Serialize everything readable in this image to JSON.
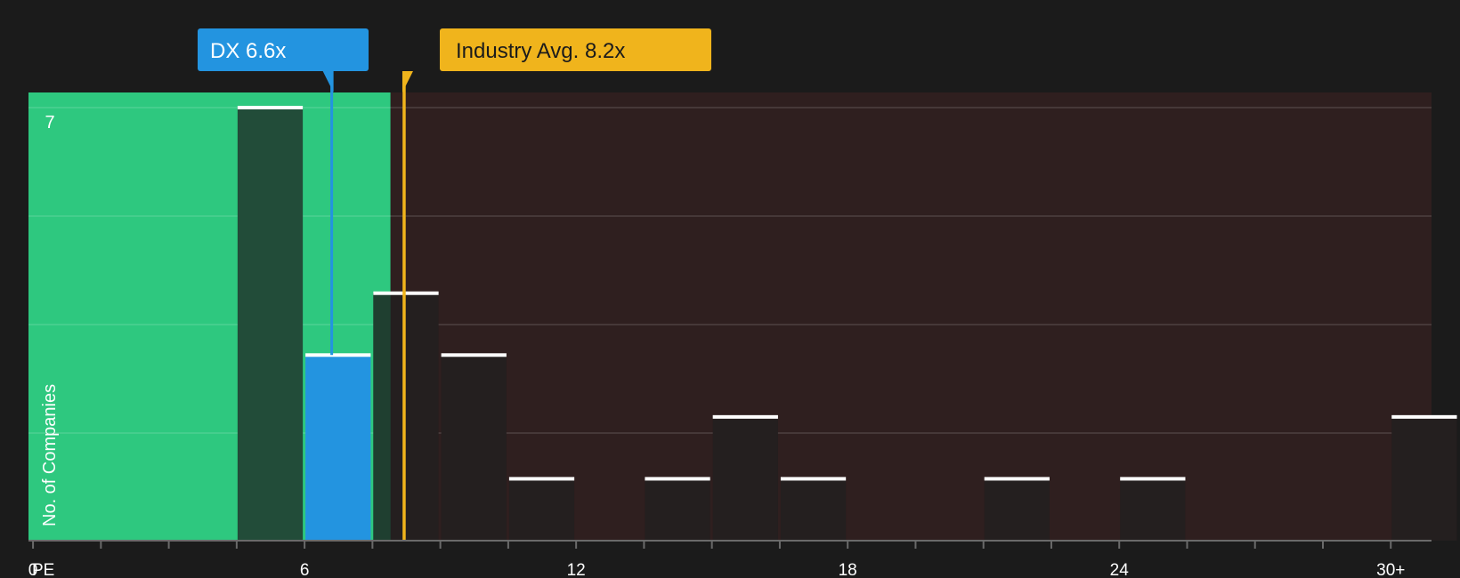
{
  "chart_data": {
    "type": "bar",
    "x_axis_prefix": "PE",
    "ylabel": "No. of Companies",
    "ylim": [
      0,
      7
    ],
    "y_top_label": "7",
    "xlim": [
      -0.1,
      30.9
    ],
    "x_ticks": [
      {
        "value": 0,
        "label": "0"
      },
      {
        "value": 6,
        "label": "6"
      },
      {
        "value": 12,
        "label": "12"
      },
      {
        "value": 18,
        "label": "18"
      },
      {
        "value": 24,
        "label": "24"
      },
      {
        "value": 30,
        "label": "30+"
      }
    ],
    "bins": [
      {
        "start": 4.5,
        "end": 6.0,
        "count": 7,
        "segment": "below"
      },
      {
        "start": 6.0,
        "end": 7.5,
        "count": 3,
        "segment": "company"
      },
      {
        "start": 7.5,
        "end": 9.0,
        "count": 4,
        "segment": "above"
      },
      {
        "start": 9.0,
        "end": 10.5,
        "count": 3,
        "segment": "above"
      },
      {
        "start": 10.5,
        "end": 12.0,
        "count": 1,
        "segment": "above"
      },
      {
        "start": 13.5,
        "end": 15.0,
        "count": 1,
        "segment": "above"
      },
      {
        "start": 15.0,
        "end": 16.5,
        "count": 2,
        "segment": "above"
      },
      {
        "start": 16.5,
        "end": 18.0,
        "count": 1,
        "segment": "above"
      },
      {
        "start": 21.0,
        "end": 22.5,
        "count": 1,
        "segment": "above"
      },
      {
        "start": 24.0,
        "end": 25.5,
        "count": 1,
        "segment": "above"
      },
      {
        "start": 30.0,
        "end": 31.5,
        "count": 2,
        "segment": "above"
      }
    ],
    "fair_region_end": 7.9,
    "company": {
      "label": "DX 6.6x",
      "value": 6.6,
      "color": "#2394e0"
    },
    "industry": {
      "label": "Industry Avg. 8.2x",
      "value": 8.2,
      "color": "#f0b41c"
    },
    "colors": {
      "fair_region": "#2ec87f",
      "overvalued_region": "#2f1f1f",
      "bar_in_fair": "#224c39",
      "bar_in_over": "#241f1f",
      "company_bar": "#2394e0",
      "bar_top": "#ffffff"
    }
  }
}
